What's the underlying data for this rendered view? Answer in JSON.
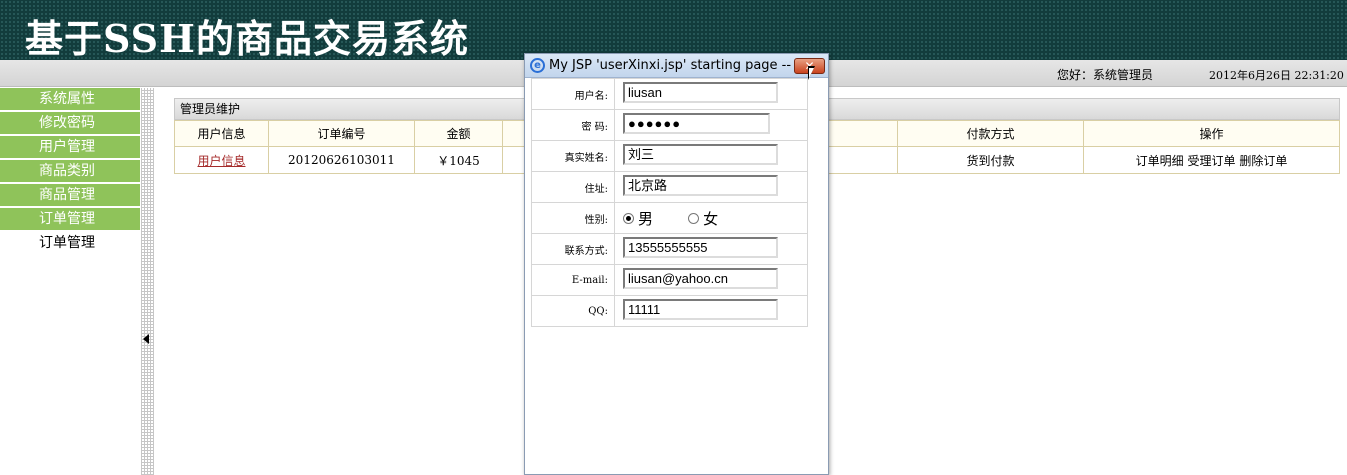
{
  "header": {
    "title": "基于SSH的商品交易系统"
  },
  "status": {
    "greeting": "您好：系统管理员",
    "datetime": "2012年6月26日  22:31:20"
  },
  "sidebar": {
    "items": [
      {
        "label": "系统属性"
      },
      {
        "label": "修改密码"
      },
      {
        "label": "用户管理"
      },
      {
        "label": "商品类别"
      },
      {
        "label": "商品管理"
      },
      {
        "label": "订单管理"
      },
      {
        "label": "订单管理"
      }
    ]
  },
  "panel": {
    "title": "管理员维护",
    "columns": [
      "用户信息",
      "订单编号",
      "金额",
      "",
      "付款方式",
      "操作"
    ],
    "rows": [
      {
        "user_info": "用户信息",
        "order_no": "20120626103011",
        "amount": "￥1045",
        "payment": "货到付款",
        "action_detail": "订单明细",
        "action_accept": "受理订单",
        "action_delete": "删除订单"
      }
    ]
  },
  "popup": {
    "title": "My JSP 'userXinxi.jsp' starting page -- ...",
    "close_label": "✕",
    "fields": {
      "username_label": "用户名:",
      "username_value": "liusan",
      "password_label": "密  码:",
      "password_value": "●●●●●●",
      "realname_label": "真实姓名:",
      "realname_value": "刘三",
      "address_label": "住址:",
      "address_value": "北京路",
      "gender_label": "性别:",
      "gender_male": "男",
      "gender_female": "女",
      "gender_selected": "男",
      "phone_label": "联系方式:",
      "phone_value": "13555555555",
      "email_label": "E-mail:",
      "email_value": "liusan@yahoo.cn",
      "qq_label": "QQ:",
      "qq_value": "11111"
    }
  },
  "icons": {
    "ie": "ie-page-icon",
    "close": "close-icon",
    "collapse": "collapse-arrow-icon",
    "cursor": "mouse-pointer-icon"
  },
  "colors": {
    "header_bg": "#123c3c",
    "sidebar_item_bg": "#8fc35a",
    "close_button": "#c9431e",
    "link_red": "#a52a2a"
  }
}
